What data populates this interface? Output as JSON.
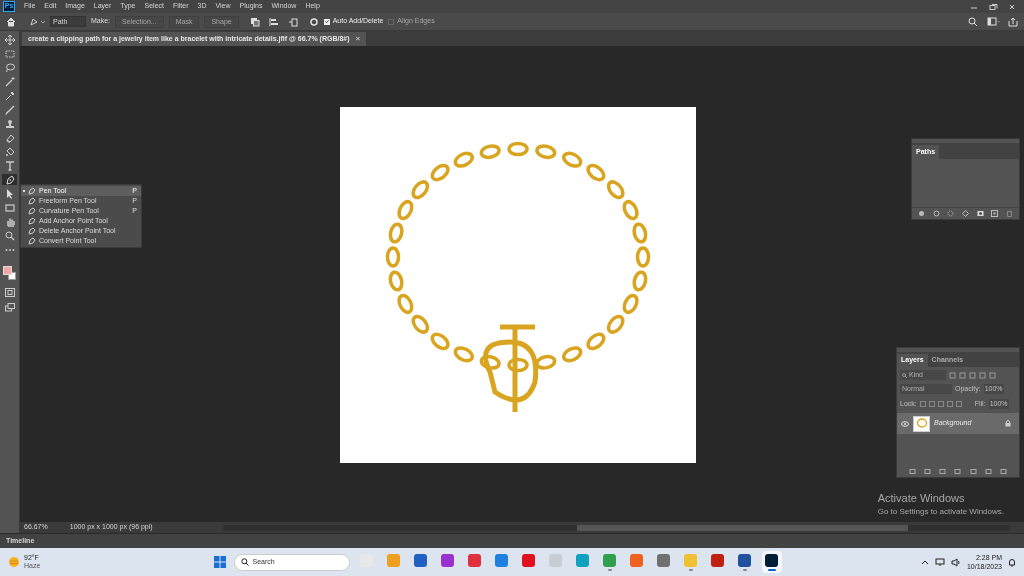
{
  "app_icon": "Ps",
  "menu": [
    "File",
    "Edit",
    "Image",
    "Layer",
    "Type",
    "Select",
    "Filter",
    "3D",
    "View",
    "Plugins",
    "Window",
    "Help"
  ],
  "options_bar": {
    "mode": "Path",
    "make_label": "Make:",
    "buttons": [
      {
        "label": "Selection...",
        "disabled": true
      },
      {
        "label": "Mask",
        "disabled": true
      },
      {
        "label": "Shape",
        "disabled": true
      }
    ],
    "checkboxes": [
      {
        "label": "Auto Add/Delete",
        "checked": true,
        "disabled": false
      },
      {
        "label": "Align Edges",
        "checked": false,
        "disabled": true
      }
    ]
  },
  "document_tab": {
    "title": "create a clipping path for a jewelry item like a bracelet with intricate details.jfif @ 66.7% (RGB/8#)",
    "close": "×"
  },
  "tools": [
    {
      "kind": "move",
      "selected": false
    },
    {
      "kind": "marquee",
      "selected": false
    },
    {
      "kind": "lasso",
      "selected": false
    },
    {
      "kind": "wand",
      "selected": false
    },
    {
      "kind": "dropper",
      "selected": false
    },
    {
      "kind": "brush",
      "selected": false
    },
    {
      "kind": "stamp",
      "selected": false
    },
    {
      "kind": "eraser",
      "selected": false
    },
    {
      "kind": "bucket",
      "selected": false
    },
    {
      "kind": "type",
      "selected": false
    },
    {
      "kind": "pen",
      "selected": true
    },
    {
      "kind": "arrow",
      "selected": false
    },
    {
      "kind": "rect",
      "selected": false
    },
    {
      "kind": "hand",
      "selected": false
    },
    {
      "kind": "zoom",
      "selected": false
    },
    {
      "kind": "more",
      "selected": false
    }
  ],
  "flyout": [
    {
      "label": "Pen Tool",
      "shortcut": "P",
      "selected": true
    },
    {
      "label": "Freeform Pen Tool",
      "shortcut": "P",
      "selected": false
    },
    {
      "label": "Curvature Pen Tool",
      "shortcut": "P",
      "selected": false
    },
    {
      "label": "Add Anchor Point Tool",
      "selected": false
    },
    {
      "label": "Delete Anchor Point Tool",
      "selected": false
    },
    {
      "label": "Convert Point Tool",
      "selected": false
    }
  ],
  "paths_panel": {
    "tab": "Paths"
  },
  "layers_panel": {
    "tabs": [
      {
        "label": "Layers",
        "selected": true
      },
      {
        "label": "Channels",
        "selected": false
      }
    ],
    "filter_placeholder": "Kind",
    "blend_mode": "Normal",
    "opacity_label": "Opacity:",
    "opacity": "100%",
    "lock_label": "Lock:",
    "fill_label": "Fill:",
    "fill": "100%",
    "layers": [
      {
        "name": "Background",
        "visible": true,
        "locked": true,
        "selected": true
      }
    ]
  },
  "status_bar": {
    "zoom": "66.67%",
    "info": "1000 px x 1000 px (96 ppi)"
  },
  "timeline": {
    "label": "Timeline"
  },
  "activation": {
    "title": "Activate Windows",
    "subtitle": "Go to Settings to activate Windows."
  },
  "taskbar": {
    "weather": {
      "temp": "92°F",
      "condition": "Haze"
    },
    "search_placeholder": "Search",
    "apps": [
      {
        "color": "#e8e8e8",
        "running": false,
        "selected": false
      },
      {
        "color": "#f0a020",
        "running": false,
        "selected": false
      },
      {
        "color": "#2060c0",
        "running": false,
        "selected": false
      },
      {
        "color": "#9b30d0",
        "running": false,
        "selected": false
      },
      {
        "color": "#e03040",
        "running": false,
        "selected": false
      },
      {
        "color": "#2080e0",
        "running": false,
        "selected": false
      },
      {
        "color": "#e01020",
        "running": false,
        "selected": false
      },
      {
        "color": "#c8ccd4",
        "running": false,
        "selected": false
      },
      {
        "color": "#10a0c0",
        "running": false,
        "selected": false
      },
      {
        "color": "#30a050",
        "running": true,
        "selected": false
      },
      {
        "color": "#f06020",
        "running": false,
        "selected": false
      },
      {
        "color": "#707070",
        "running": false,
        "selected": false
      },
      {
        "color": "#f0c030",
        "running": true,
        "selected": false
      },
      {
        "color": "#c02010",
        "running": false,
        "selected": false
      },
      {
        "color": "#2050a0",
        "running": true,
        "selected": false
      },
      {
        "color": "#001e36",
        "running": true,
        "selected": true
      }
    ],
    "time": "2:28 PM",
    "date": "10/18/2023"
  }
}
